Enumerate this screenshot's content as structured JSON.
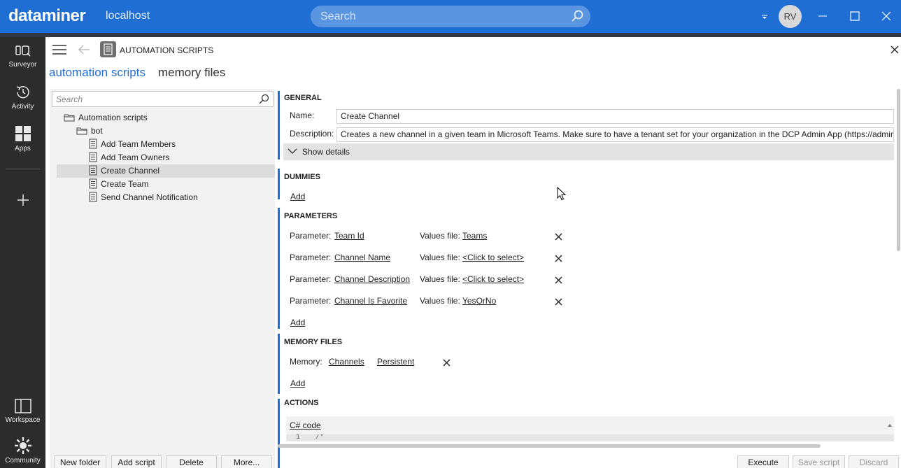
{
  "app": {
    "brand": "dataminer",
    "host": "localhost",
    "search_placeholder": "Search",
    "user_initials": "RV"
  },
  "rail": {
    "items": [
      {
        "label": "Surveyor",
        "icon": "surveyor-icon"
      },
      {
        "label": "Activity",
        "icon": "activity-icon"
      },
      {
        "label": "Apps",
        "icon": "apps-icon"
      },
      {
        "label": "Workspace",
        "icon": "workspace-icon"
      },
      {
        "label": "Community",
        "icon": "community-icon"
      }
    ]
  },
  "header": {
    "title": "AUTOMATION SCRIPTS",
    "tabs": [
      "automation scripts",
      "memory files"
    ]
  },
  "tree": {
    "search_placeholder": "Search",
    "root": "Automation scripts",
    "folder": "bot",
    "scripts": [
      "Add Team Members",
      "Add Team Owners",
      "Create Channel",
      "Create Team",
      "Send Channel Notification"
    ],
    "selected": "Create Channel"
  },
  "left_buttons": [
    "New folder",
    "Add script",
    "Delete",
    "More..."
  ],
  "right_buttons": [
    "Execute",
    "Save script",
    "Discard"
  ],
  "general": {
    "title": "GENERAL",
    "name_label": "Name:",
    "name_value": "Create Channel",
    "description_label": "Description:",
    "description_value": "Creates a new channel in a given team in Microsoft Teams. Make sure to have a tenant set for your organization in the DCP Admin App (https://admin",
    "show_details": "Show details"
  },
  "dummies": {
    "title": "DUMMIES",
    "add": "Add"
  },
  "parameters": {
    "title": "PARAMETERS",
    "param_label": "Parameter:",
    "values_label": "Values file:",
    "rows": [
      {
        "name": "Team Id",
        "values_file": "Teams"
      },
      {
        "name": "Channel Name",
        "values_file": "<Click to select>"
      },
      {
        "name": "Channel Description",
        "values_file": "<Click to select>"
      },
      {
        "name": "Channel Is Favorite",
        "values_file": "YesOrNo"
      }
    ],
    "add": "Add"
  },
  "memory_files": {
    "title": "MEMORY FILES",
    "label": "Memory:",
    "name": "Channels",
    "type": "Persistent",
    "add": "Add"
  },
  "actions": {
    "title": "ACTIONS",
    "code_label": "C# code",
    "line_number": "1",
    "line_text": "/*"
  }
}
